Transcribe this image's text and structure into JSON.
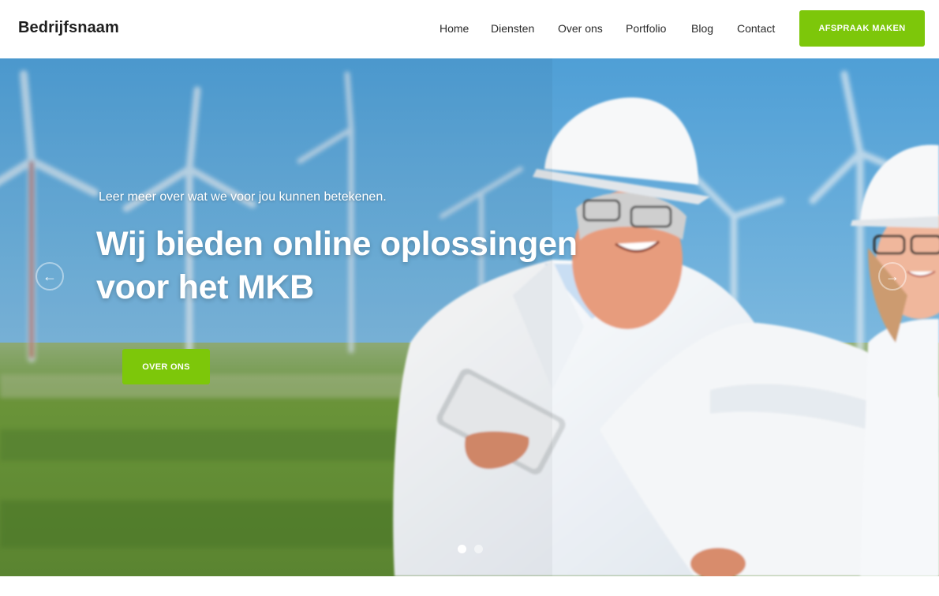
{
  "header": {
    "brand": "Bedrijfsnaam",
    "nav": [
      {
        "label": "Home"
      },
      {
        "label": "Diensten"
      },
      {
        "label": "Over ons"
      },
      {
        "label": "Portfolio"
      },
      {
        "label": "Blog"
      },
      {
        "label": "Contact"
      }
    ],
    "cta_label": "AFSPRAAK MAKEN"
  },
  "hero": {
    "kicker": "Leer meer over wat we voor jou kunnen betekenen.",
    "headline_line1": "Wij bieden online oplossingen",
    "headline_line2": "voor het MKB",
    "button_label": "OVER ONS",
    "prev_icon": "arrow-left-icon",
    "next_icon": "arrow-right-icon",
    "slides": 2,
    "active_slide": 1
  },
  "colors": {
    "accent": "#7dc70a",
    "sky": "#5aa6d8",
    "grass": "#6f9a3c"
  }
}
